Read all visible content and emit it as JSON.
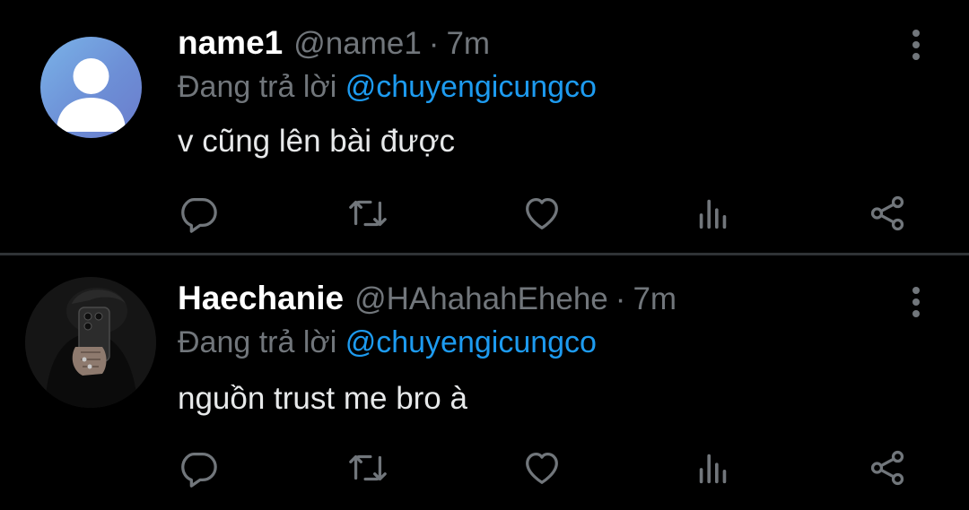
{
  "theme": {
    "background": "#000000",
    "text": "#e7e9ea",
    "muted": "#71767b",
    "accent": "#1d9bf0",
    "divider": "#2f3336"
  },
  "tweets": [
    {
      "name": "name1",
      "handle": "@name1",
      "separator": "·",
      "time": "7m",
      "replying_prefix": "Đang trả lời",
      "replying_to": "@chuyengicungco",
      "text": "v cũng lên bài được",
      "avatar": "default-avatar-icon",
      "actions": [
        "reply-icon",
        "retweet-icon",
        "like-icon",
        "views-icon",
        "share-icon"
      ]
    },
    {
      "name": "Haechanie",
      "handle": "@HAhahahEhehe",
      "separator": "·",
      "time": "7m",
      "replying_prefix": "Đang trả lời",
      "replying_to": "@chuyengicungco",
      "text": "nguồn trust me bro à",
      "avatar": "mirror-selfie-photo",
      "actions": [
        "reply-icon",
        "retweet-icon",
        "like-icon",
        "views-icon",
        "share-icon"
      ]
    }
  ]
}
